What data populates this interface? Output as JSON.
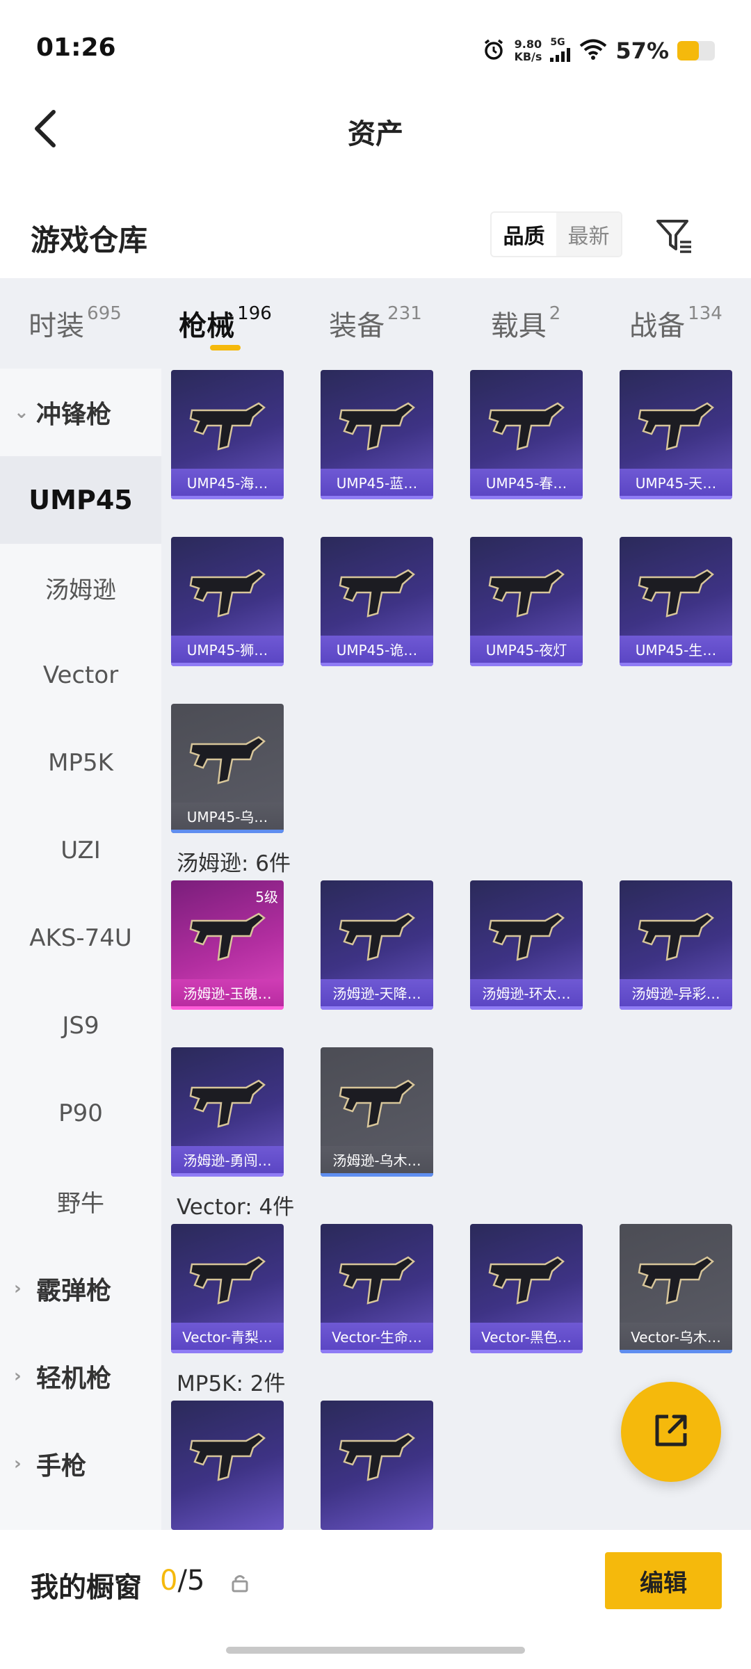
{
  "status": {
    "time": "01:26",
    "net_speed_value": "9.80",
    "net_speed_unit": "KB/s",
    "signal": "5G",
    "battery_percent_text": "57%",
    "battery_level": 0.57,
    "icons": [
      "alarm-icon",
      "signal-icon",
      "wifi-icon",
      "battery-icon"
    ]
  },
  "header": {
    "title": "资产",
    "back_icon": "chevron-left-icon"
  },
  "warehouse": {
    "title": "游戏仓库",
    "sort_options": [
      "品质",
      "最新"
    ],
    "sort_selected": "品质",
    "filter_icon": "filter-icon"
  },
  "tabs": [
    {
      "label": "时装",
      "count": "695"
    },
    {
      "label": "枪械",
      "count": "196",
      "active": true
    },
    {
      "label": "装备",
      "count": "231"
    },
    {
      "label": "载具",
      "count": "2"
    },
    {
      "label": "战备",
      "count": "134"
    }
  ],
  "sidebar": {
    "items": [
      {
        "label": "冲锋枪",
        "type": "category",
        "expanded": true
      },
      {
        "label": "UMP45",
        "type": "sub",
        "selected": true
      },
      {
        "label": "汤姆逊",
        "type": "sub"
      },
      {
        "label": "Vector",
        "type": "sub"
      },
      {
        "label": "MP5K",
        "type": "sub"
      },
      {
        "label": "UZI",
        "type": "sub"
      },
      {
        "label": "AKS-74U",
        "type": "sub"
      },
      {
        "label": "JS9",
        "type": "sub"
      },
      {
        "label": "P90",
        "type": "sub"
      },
      {
        "label": "野牛",
        "type": "sub"
      },
      {
        "label": "霰弹枪",
        "type": "category"
      },
      {
        "label": "轻机枪",
        "type": "category"
      },
      {
        "label": "手枪",
        "type": "category"
      }
    ]
  },
  "groups": [
    {
      "title": "",
      "items": [
        {
          "name": "UMP45-海…",
          "style": "purple"
        },
        {
          "name": "UMP45-蓝…",
          "style": "purple"
        },
        {
          "name": "UMP45-春…",
          "style": "purple"
        },
        {
          "name": "UMP45-天…",
          "style": "purple"
        },
        {
          "name": "UMP45-狮…",
          "style": "purple"
        },
        {
          "name": "UMP45-诡…",
          "style": "purple"
        },
        {
          "name": "UMP45-夜灯",
          "style": "purple"
        },
        {
          "name": "UMP45-生…",
          "style": "purple"
        },
        {
          "name": "UMP45-乌…",
          "style": "grey"
        }
      ]
    },
    {
      "title": "汤姆逊: 6件",
      "items": [
        {
          "name": "汤姆逊-玉魄…",
          "style": "pink",
          "badge": "5级"
        },
        {
          "name": "汤姆逊-天降…",
          "style": "purple"
        },
        {
          "name": "汤姆逊-环太…",
          "style": "purple"
        },
        {
          "name": "汤姆逊-异彩…",
          "style": "purple"
        },
        {
          "name": "汤姆逊-勇闯…",
          "style": "purple"
        },
        {
          "name": "汤姆逊-乌木…",
          "style": "grey"
        }
      ]
    },
    {
      "title": "Vector: 4件",
      "items": [
        {
          "name": "Vector-青梨…",
          "style": "purple"
        },
        {
          "name": "Vector-生命…",
          "style": "purple"
        },
        {
          "name": "Vector-黑色…",
          "style": "purple"
        },
        {
          "name": "Vector-乌木…",
          "style": "grey"
        }
      ]
    },
    {
      "title": "MP5K: 2件",
      "items": [
        {
          "name": "",
          "style": "purple"
        },
        {
          "name": "",
          "style": "purple"
        }
      ]
    }
  ],
  "fab": {
    "icon": "share-icon"
  },
  "showcase": {
    "label": "我的橱窗",
    "current": "0",
    "separator": "/",
    "max": "5",
    "lock_icon": "lock-icon",
    "edit_label": "编辑"
  },
  "colors": {
    "accent": "#f5b90c",
    "card_purple": "#3e3385",
    "card_grey": "#5b5c66",
    "card_pink": "#b22ea0"
  }
}
